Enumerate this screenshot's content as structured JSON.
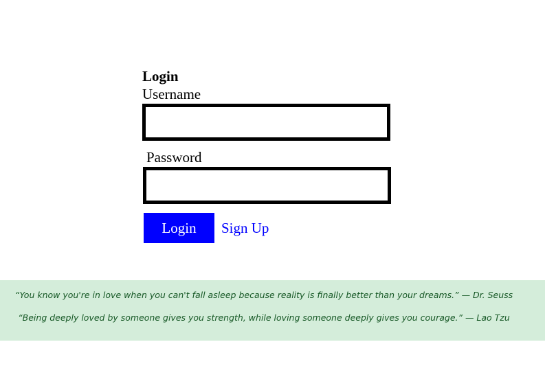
{
  "login_form": {
    "title": "Login",
    "username_label": "Username",
    "username_value": "",
    "password_label": "Password",
    "password_value": "",
    "login_button": "Login",
    "signup_link": "Sign Up"
  },
  "quotes": [
    "“You know you're in love when you can't fall asleep because reality is finally better than your dreams.” — Dr. Seuss",
    "“Being deeply loved by someone gives you strength, while loving someone deeply gives you courage.” — Lao Tzu"
  ],
  "colors": {
    "button_bg": "#0000ff",
    "link": "#0000ff",
    "banner_bg": "#d4edda",
    "quote_text": "#155724"
  }
}
